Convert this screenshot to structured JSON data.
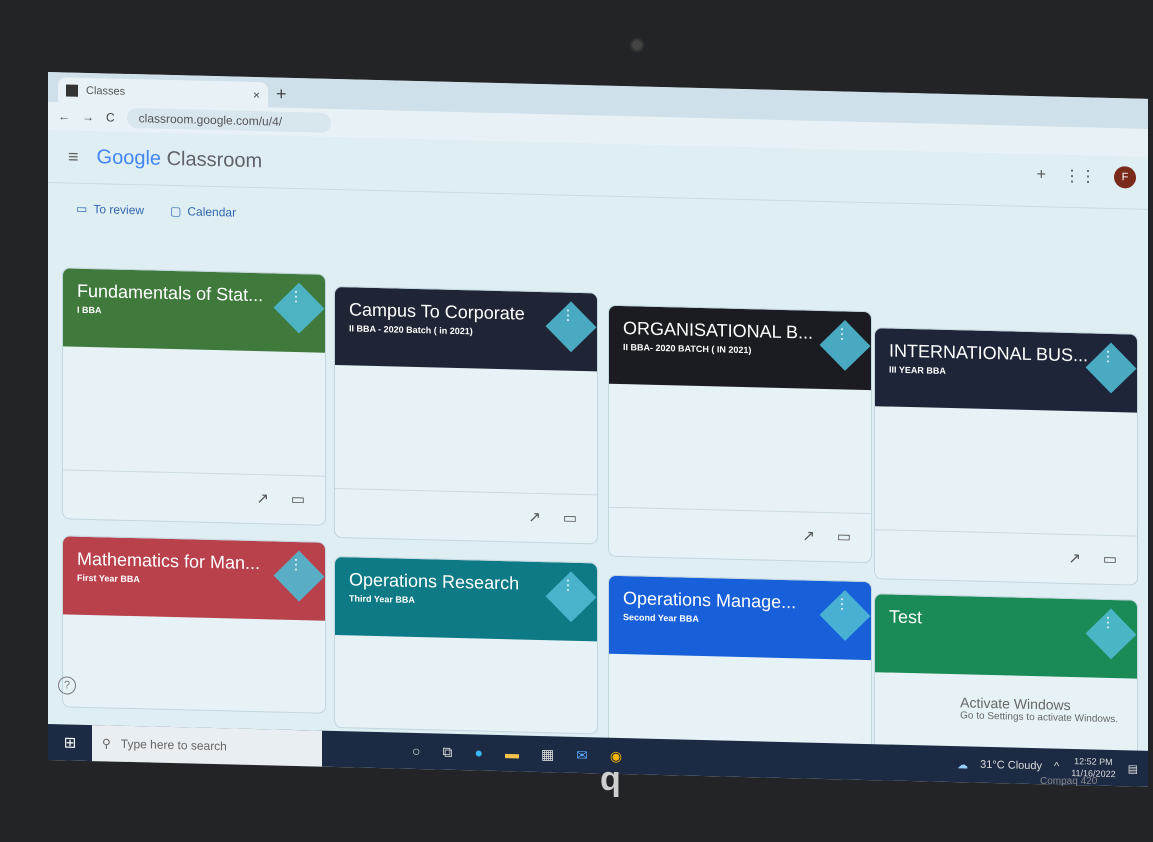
{
  "browser": {
    "tab_title": "Classes",
    "tab_close": "×",
    "new_tab": "+",
    "url": "classroom.google.com/u/4/"
  },
  "header": {
    "logo_google": "Google",
    "logo_classroom": "Classroom",
    "avatar_letter": "F"
  },
  "subnav": {
    "to_review": "To review",
    "calendar": "Calendar"
  },
  "classes": [
    {
      "title": "Fundamentals of Stat...",
      "section": "I BBA",
      "color": "#3f7a3c"
    },
    {
      "title": "Campus To Corporate",
      "section": "II BBA - 2020 Batch ( in 2021)",
      "color": "#1f2535"
    },
    {
      "title": "ORGANISATIONAL B...",
      "section": "II BBA- 2020 BATCH ( IN 2021)",
      "color": "#1b1c22"
    },
    {
      "title": "INTERNATIONAL BUS...",
      "section": "III YEAR BBA",
      "color": "#1e2538"
    },
    {
      "title": "Mathematics for Man...",
      "section": "First Year BBA",
      "color": "#b9414c"
    },
    {
      "title": "Operations Research",
      "section": "Third Year BBA",
      "color": "#0e7a86"
    },
    {
      "title": "Operations Manage...",
      "section": "Second Year BBA",
      "color": "#1760d9"
    },
    {
      "title": "Test",
      "section": "",
      "color": "#1a8a56"
    }
  ],
  "watermark": {
    "title": "Activate Windows",
    "subtitle": "Go to Settings to activate Windows."
  },
  "taskbar": {
    "search_placeholder": "Type here to search",
    "weather": "31°C  Cloudy",
    "time": "12:52 PM",
    "date": "11/16/2022"
  },
  "laptop": {
    "model": "Compaq   420"
  }
}
